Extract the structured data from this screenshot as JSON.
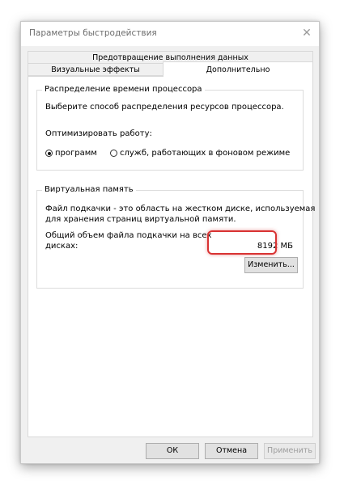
{
  "window": {
    "title": "Параметры быстродействия",
    "close_glyph": "✕"
  },
  "tabs": {
    "row1": [
      "Предотвращение выполнения данных"
    ],
    "row2": [
      "Визуальные эффекты",
      "Дополнительно"
    ],
    "active": "Дополнительно"
  },
  "cpu": {
    "group_title": "Распределение времени процессора",
    "description": "Выберите способ распределения ресурсов процессора.",
    "optimize_label": "Оптимизировать работу:",
    "option_programs": "программ",
    "option_services": "служб, работающих в фоновом режиме",
    "selected": "программ"
  },
  "virtual_memory": {
    "group_title": "Виртуальная память",
    "desc_line1": "Файл подкачки - это область на жестком диске, используемая",
    "desc_line2": "для хранения страниц виртуальной памяти.",
    "total_line1": "Общий объем файла подкачки на всех",
    "total_line2": "дисках:",
    "total_value": "8192 МБ",
    "change_button": "Изменить..."
  },
  "footer": {
    "ok": "ОК",
    "cancel": "Отмена",
    "apply": "Применить"
  },
  "colors": {
    "highlight": "#d93333",
    "dialog_bg": "#f0f0f0",
    "panel_bg": "#ffffff"
  }
}
